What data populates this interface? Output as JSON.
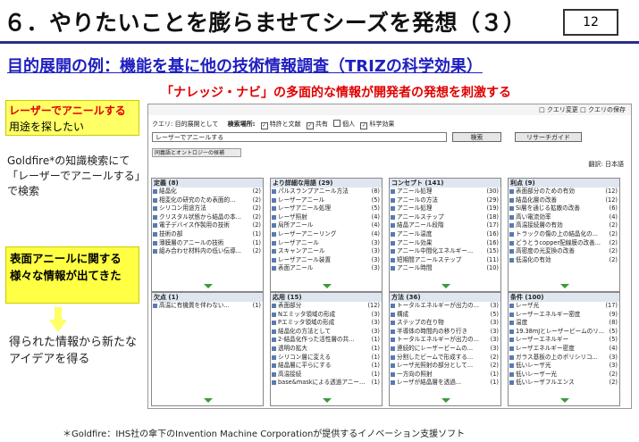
{
  "title": "６．やりたいことを膨らませてシーズを発想（３）",
  "page_number": "12",
  "subtitle": "目的展開の例：機能を基に他の技術情報調査（TRIZの科学効果）",
  "tagline": "「ナレッジ・ナビ」の多面的な情報が開発者の発想を刺激する",
  "box1": {
    "red": "レーザーでアニールする",
    "rest": "用途を探したい"
  },
  "note2": "Goldfire*の知識検索にて「レーザーでアニールする」で検索",
  "box2": "表面アニールに関する様々な情報が出てきた",
  "note3": "得られた情報から新たなアイデアを得る",
  "footnote": "＊Goldfire：IHS社の傘下のInvention Machine Corporationが提供するイノベーション支援ソフト",
  "colors": {
    "accent_blue": "#2020c0",
    "red": "#e00000",
    "highlight": "#ffff44"
  },
  "app": {
    "top_links": "□ クエリ変更  □ クエリの保存",
    "query_label": "クエリ: 目的展開として",
    "search_scope": "検索場所:",
    "scopes": [
      "特許と文献",
      "共有",
      "個人",
      "科学効果"
    ],
    "query_value": "レーザーでアニールする",
    "search_button": "検索",
    "research_button": "リサーチガイド",
    "onto_tab": "同義語とオントロジーの候補",
    "display": "翻訳: 日本語",
    "panels": [
      {
        "title": "定義 (8)",
        "items": [
          [
            "結晶化",
            "(2)"
          ],
          [
            "相変化の研究のため表面的...",
            "(2)"
          ],
          [
            "シリコン用途方法",
            "(2)"
          ],
          [
            "クリスタル状態から結晶の本...",
            "(2)"
          ],
          [
            "電子デバイス作製用の技術",
            "(2)"
          ],
          [
            "技術の部",
            "(1)"
          ],
          [
            "薄膜層のアニールの技術",
            "(1)"
          ],
          [
            "組み合わせ材料内の低い伝導...",
            "(2)"
          ]
        ]
      },
      {
        "title": "より詳細な用語 (29)",
        "items": [
          [
            "パルスランプアニール方法",
            "(8)"
          ],
          [
            "レーザーアニール",
            "(5)"
          ],
          [
            "レーザアニール処理",
            "(5)"
          ],
          [
            "レーザ照射",
            "(4)"
          ],
          [
            "局所アニール",
            "(4)"
          ],
          [
            "レーザーアニーリング",
            "(4)"
          ],
          [
            "レーザアニール",
            "(3)"
          ],
          [
            "スキャンアニール",
            "(3)"
          ],
          [
            "レーザアニール装置",
            "(3)"
          ],
          [
            "表面アニール",
            "(3)"
          ]
        ]
      },
      {
        "title": "コンセプト (141)",
        "items": [
          [
            "アニール処理",
            "(30)"
          ],
          [
            "アニールの方法",
            "(29)"
          ],
          [
            "アニール処理",
            "(19)"
          ],
          [
            "アニールステップ",
            "(18)"
          ],
          [
            "結晶アニール段階",
            "(17)"
          ],
          [
            "アニール温度",
            "(16)"
          ],
          [
            "アニール効果",
            "(16)"
          ],
          [
            "アニール中間化エネルギー...",
            "(15)"
          ],
          [
            "短期間アニールステップ",
            "(11)"
          ],
          [
            "アニール時間",
            "(10)"
          ]
        ]
      },
      {
        "title": "利点 (9)",
        "items": [
          [
            "表面部分のための有効",
            "(12)"
          ],
          [
            "結晶化層の改善",
            "(12)"
          ],
          [
            "Si層を通じる拡散の改善",
            "(6)"
          ],
          [
            "高い電流効率",
            "(4)"
          ],
          [
            "高温接続層の有効",
            "(2)"
          ],
          [
            "トラックの傷の上の結晶化の...",
            "(2)"
          ],
          [
            "どうとうcopper配線膜の改善...",
            "(2)"
          ],
          [
            "高密度の光変換の改善",
            "(2)"
          ],
          [
            "低温化の有効",
            "(2)"
          ]
        ]
      },
      {
        "title": "欠点 (1)",
        "items": [
          [
            "高温に有機質を伴わない...",
            "(1)"
          ]
        ]
      },
      {
        "title": "応用 (15)",
        "items": [
          [
            "表面部分",
            "(12)"
          ],
          [
            "Nエミッタ領域の形成",
            "(3)"
          ],
          [
            "Pエミッタ領域の形成",
            "(3)"
          ],
          [
            "結晶化の方法として",
            "(3)"
          ],
          [
            "2-結晶化作った活性層の共...",
            "(1)"
          ],
          [
            "透明の拡大",
            "(1)"
          ],
          [
            "シリコン層に変える",
            "(1)"
          ],
          [
            "結晶層に平らにする",
            "(1)"
          ],
          [
            "高温接続",
            "(1)"
          ],
          [
            "base&maskによる透過アニー...",
            "(1)"
          ]
        ]
      },
      {
        "title": "方法 (36)",
        "items": [
          [
            "トータルエネルギーが出力の...",
            "(3)"
          ],
          [
            "構成",
            "(5)"
          ],
          [
            "ステップの在り物",
            "(3)"
          ],
          [
            "半導体の時間内の移り行き",
            "(3)"
          ],
          [
            "トータルエネルギーが出力の...",
            "(3)"
          ],
          [
            "連続的にレーザービームの...",
            "(3)"
          ],
          [
            "分割したビームで形成する...",
            "(2)"
          ],
          [
            "レーザ光照射の部分として...",
            "(2)"
          ],
          [
            "一方向の照射",
            "(1)"
          ],
          [
            "レーザが結晶層を透過...",
            "(1)"
          ]
        ]
      },
      {
        "title": "条件 (100)",
        "items": [
          [
            "レーザ光",
            "(17)"
          ],
          [
            "レーザーエネルギー密度",
            "(9)"
          ],
          [
            "温度",
            "(8)"
          ],
          [
            "19.38mJとレーザービームのリ...",
            "(5)"
          ],
          [
            "レーザーエネルギー",
            "(5)"
          ],
          [
            "レーザエネルギー密度",
            "(4)"
          ],
          [
            "ガラス基板の上のポリシリコ...",
            "(3)"
          ],
          [
            "低いレーザ光",
            "(3)"
          ],
          [
            "低いレーザー光",
            "(2)"
          ],
          [
            "低いレーザフルエンス",
            "(2)"
          ]
        ]
      }
    ]
  }
}
